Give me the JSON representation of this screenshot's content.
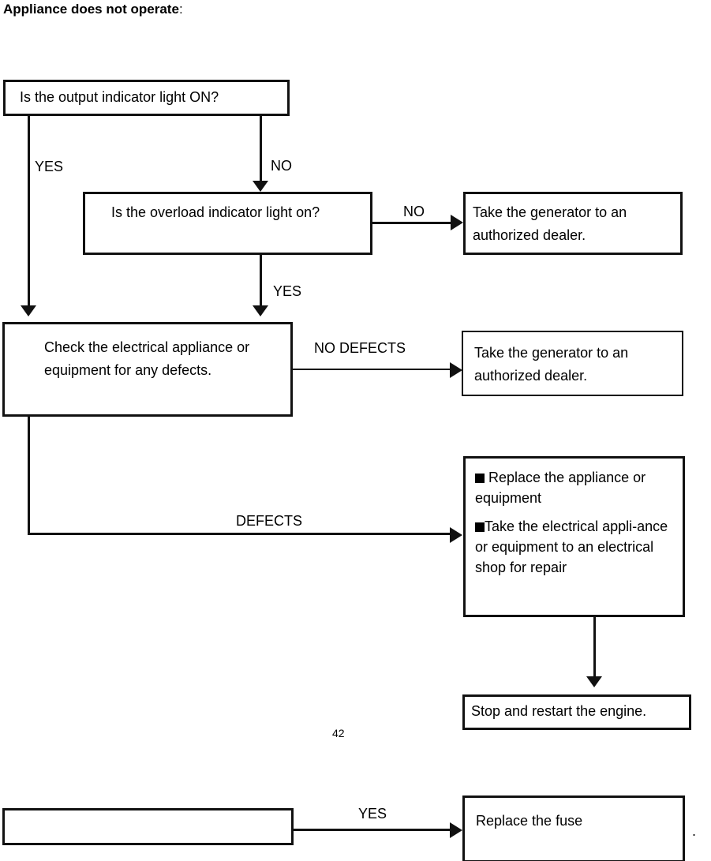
{
  "heading": {
    "bold_text": "Appliance does not operate",
    "suffix": ":"
  },
  "page_number": "42",
  "trailing_period": ".",
  "colors": {
    "stroke": "#111111",
    "background": "#ffffff",
    "text": "#000000"
  },
  "boxes": {
    "output_indicator": "Is the output indicator light ON?",
    "overload_indicator": "Is  the  overload  indicator  light on?",
    "dealer_1": "Take the generator to an authorized dealer.",
    "check_appliance": "Check the electrical appliance or equipment for any defects.",
    "dealer_2": "Take the generator to an authorized dealer.",
    "bullets": [
      "Replace the appliance or equipment",
      "Take the electrical appli-ance or equipment to an electrical shop for repair"
    ],
    "stop_restart": "Stop and restart the engine.",
    "empty_box": "",
    "replace_fuse": "Replace the fuse"
  },
  "edge_labels": {
    "yes_left": "YES",
    "no_top": "NO",
    "no_overload": "NO",
    "yes_overload": "YES",
    "no_defects": "NO DEFECTS",
    "defects": "DEFECTS",
    "yes_fuse": "YES"
  }
}
